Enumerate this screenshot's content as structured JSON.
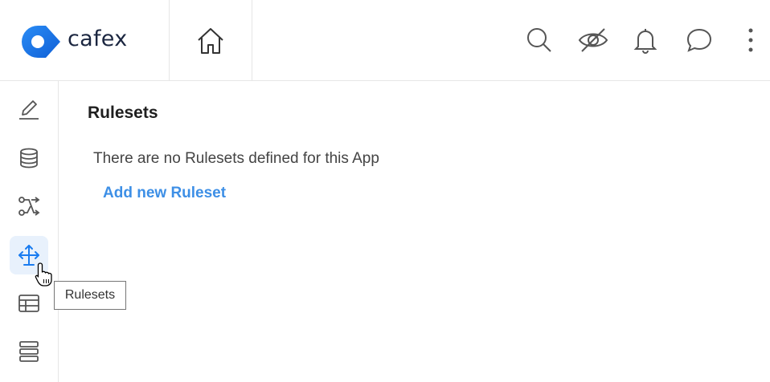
{
  "brand": {
    "name": "cafex",
    "accent": "#1a7cf0"
  },
  "header": {
    "home_icon": "home-icon",
    "actions": [
      "search-icon",
      "eye-off-icon",
      "bell-icon",
      "chat-icon",
      "kebab-menu-icon"
    ]
  },
  "rail": {
    "items": [
      {
        "icon": "edit-icon"
      },
      {
        "icon": "database-icon"
      },
      {
        "icon": "workflow-icon"
      },
      {
        "icon": "rulesets-icon",
        "active": true
      },
      {
        "icon": "table-icon"
      },
      {
        "icon": "list-icon"
      }
    ]
  },
  "main": {
    "title": "Rulesets",
    "empty_message": "There are no Rulesets defined for this App",
    "add_link": "Add new Ruleset"
  },
  "tooltip": {
    "text": "Rulesets"
  },
  "colors": {
    "link": "#3d8fe6",
    "active_bg": "#e8f1fc",
    "icon": "#555555"
  }
}
